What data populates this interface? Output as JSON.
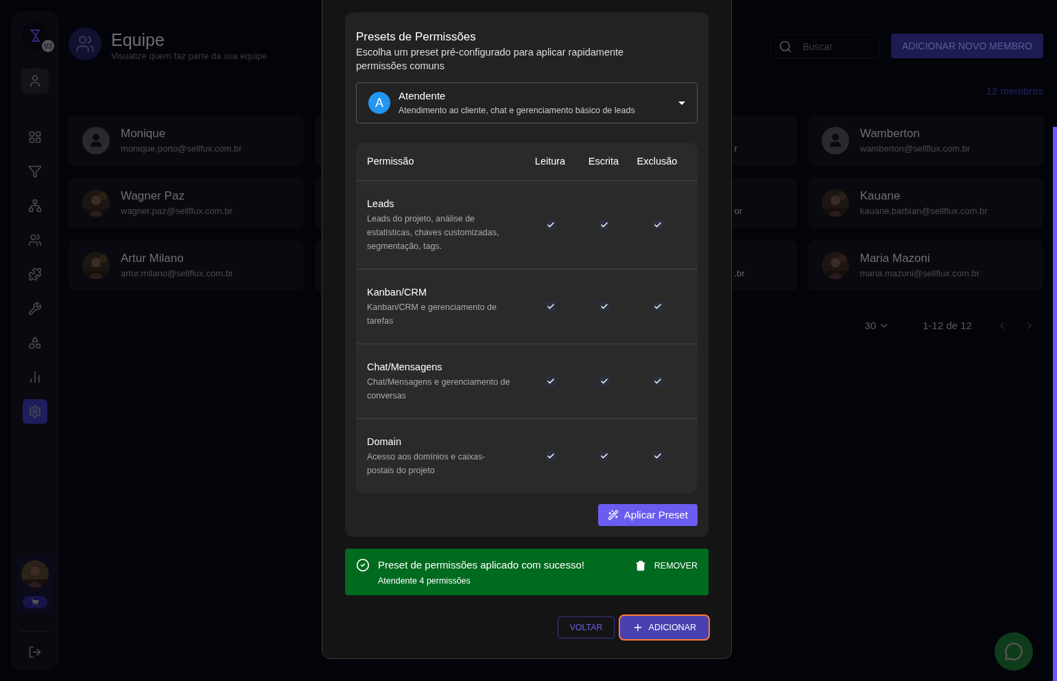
{
  "sidebar": {
    "logo_badge": "V3",
    "items": [
      {
        "kind": "profile",
        "selected": false
      },
      {
        "kind": "dashboard",
        "selected": false
      },
      {
        "kind": "filter",
        "selected": false
      },
      {
        "kind": "flow",
        "selected": false
      },
      {
        "kind": "team",
        "selected": false
      },
      {
        "kind": "puzzle",
        "selected": false
      },
      {
        "kind": "wrench",
        "selected": false
      },
      {
        "kind": "apps",
        "selected": false
      },
      {
        "kind": "chart",
        "selected": false
      },
      {
        "kind": "settings",
        "selected": true
      }
    ]
  },
  "header": {
    "title": "Equipe",
    "subtitle": "Visualize quem faz parte da sua equipe",
    "search": {
      "placeholder": "Buscar"
    },
    "add_button": "ADICIONAR NOVO MEMBRO",
    "member_count": "12 membros"
  },
  "member_rows": [
    {
      "left": {
        "kind": "default",
        "name": "Monique",
        "email": "monique.porto@sellfux.com.br"
      },
      "partial_email_end": "r",
      "right": {
        "kind": "default",
        "name": "Wamberton",
        "email": "wamberton@sellflux.com.br"
      }
    },
    {
      "left": {
        "name": "Wagner Paz",
        "email": "wagner.paz@sellflux.com.br"
      },
      "partial_email_end": "or",
      "right": {
        "name": "Kauane",
        "email": "kauane.barbian@sellflux.com.br"
      }
    },
    {
      "left": {
        "name": "Artur Milano",
        "email": "artur.milano@sellflux.com.br"
      },
      "partial_email_end": ".br",
      "right": {
        "name": "Maria Mazoni",
        "email": "maria.mazoni@sellflux.com.br"
      }
    }
  ],
  "pagination": {
    "per_page": "30",
    "range": "1-12 de 12"
  },
  "modal": {
    "presets": {
      "title": "Presets de Permissões",
      "description": "Escolha um preset pré-configurado para aplicar rapidamente permissões comuns",
      "select": {
        "avatar_letter": "A",
        "label": "Atendente",
        "description": "Atendimento ao cliente, chat e gerenciamento básico de leads"
      },
      "table": {
        "columns": [
          "Permissão",
          "Leitura",
          "Escrita",
          "Exclusão"
        ],
        "rows": [
          {
            "name": "Leads",
            "description": "Leads do projeto, análise de estatísticas, chaves customizadas, segmentação, tags.",
            "read": true,
            "write": true,
            "delete": true
          },
          {
            "name": "Kanban/CRM",
            "description": "Kanban/CRM e gerenciamento de tarefas",
            "read": true,
            "write": true,
            "delete": true
          },
          {
            "name": "Chat/Mensagens",
            "description": "Chat/Mensagens e gerenciamento de conversas",
            "read": true,
            "write": true,
            "delete": true
          },
          {
            "name": "Domain",
            "description": "Acesso aos domínios e caixas-postais do projeto",
            "read": true,
            "write": true,
            "delete": true
          }
        ]
      },
      "apply_button": "Aplicar Preset"
    },
    "alert": {
      "title": "Preset de permissões aplicado com sucesso!",
      "detail": "Atendente 4 permissões",
      "action": "REMOVER"
    },
    "back_button": "VOLTAR",
    "add_button": "ADICIONAR"
  }
}
